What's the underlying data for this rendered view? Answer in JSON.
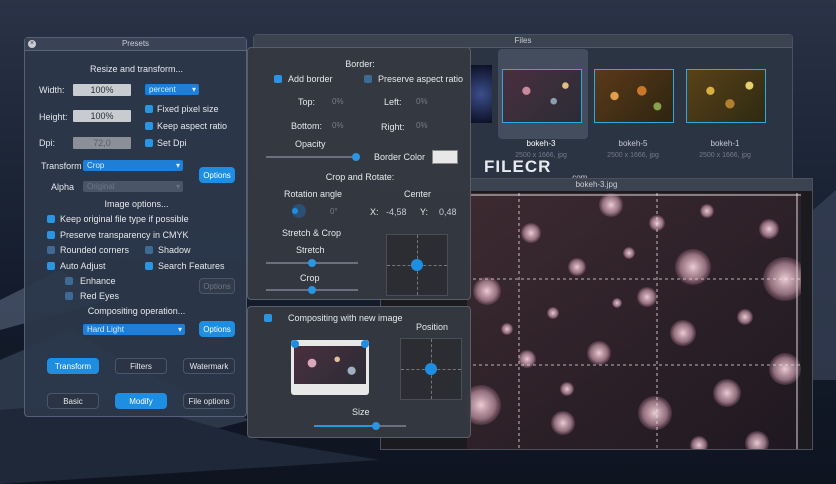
{
  "files": {
    "title": "Files",
    "thumbs": [
      {
        "label": "bokeh-3",
        "size": "2500 x 1666, jpg"
      },
      {
        "label": "bokeh-5",
        "size": "2500 x 1666, jpg"
      },
      {
        "label": "bokeh-1",
        "size": "2500 x 1666, jpg"
      }
    ],
    "watermark": "FILECR",
    "watermark_sub": ".com"
  },
  "preview": {
    "title": "bokeh-3.jpg"
  },
  "presets": {
    "title": "Presets",
    "resize_heading": "Resize and transform...",
    "width_label": "Width:",
    "width_value": "100%",
    "unit": "percent",
    "height_label": "Height:",
    "height_value": "100%",
    "dpi_label": "Dpi:",
    "dpi_value": "72,0",
    "fixed_pixel": "Fixed pixel size",
    "keep_aspect": "Keep aspect ratio",
    "set_dpi": "Set Dpi",
    "transform_label": "Transform",
    "transform_value": "Crop",
    "alpha_label": "Alpha",
    "alpha_value": "Original",
    "options_label": "Options",
    "image_options_heading": "Image options...",
    "keep_original": "Keep original file type if possible",
    "preserve_cmyk": "Preserve transparency in CMYK",
    "rounded": "Rounded corners",
    "shadow": "Shadow",
    "auto_adjust": "Auto Adjust",
    "search_features": "Search Features",
    "enhance": "Enhance",
    "red_eyes": "Red Eyes",
    "options2_label": "Options",
    "compositing_heading": "Compositing operation...",
    "compositing_value": "Hard Light",
    "options3_label": "Options",
    "tabs_row1": [
      "Transform",
      "Filters",
      "Watermark"
    ],
    "tabs_row2": [
      "Basic",
      "Modify",
      "File options"
    ]
  },
  "border": {
    "heading": "Border:",
    "add_border": "Add border",
    "preserve_aspect": "Preserve aspect ratio",
    "top_label": "Top:",
    "top_value": "0%",
    "left_label": "Left:",
    "left_value": "0%",
    "bottom_label": "Bottom:",
    "bottom_value": "0%",
    "right_label": "Right:",
    "right_value": "0%",
    "opacity_label": "Opacity",
    "border_color_label": "Border Color",
    "crop_heading": "Crop and Rotate:",
    "rotation_label": "Rotation angle",
    "rotation_value": "0°",
    "center_label": "Center",
    "x_label": "X:",
    "x_value": "-4,58",
    "y_label": "Y:",
    "y_value": "0,48",
    "stretch_crop_label": "Stretch & Crop",
    "stretch_label": "Stretch",
    "crop_label": "Crop"
  },
  "composite": {
    "checkbox_label": "Compositing with new image",
    "position_label": "Position",
    "size_label": "Size"
  },
  "colors": {
    "accent": "#1e8ee3"
  }
}
